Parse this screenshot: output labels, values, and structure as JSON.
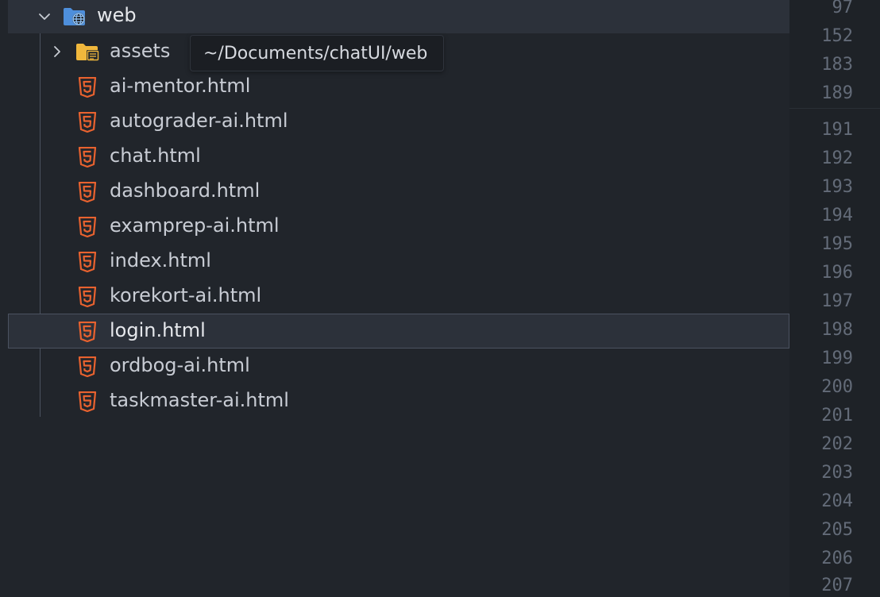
{
  "explorer": {
    "root": {
      "label": "web",
      "expanded": true,
      "icon": "web-folder-icon"
    },
    "items": [
      {
        "label": "assets",
        "type": "folder",
        "icon": "folder-icon"
      },
      {
        "label": "ai-mentor.html",
        "type": "html",
        "icon": "html5-icon"
      },
      {
        "label": "autograder-ai.html",
        "type": "html",
        "icon": "html5-icon"
      },
      {
        "label": "chat.html",
        "type": "html",
        "icon": "html5-icon"
      },
      {
        "label": "dashboard.html",
        "type": "html",
        "icon": "html5-icon"
      },
      {
        "label": "examprep-ai.html",
        "type": "html",
        "icon": "html5-icon"
      },
      {
        "label": "index.html",
        "type": "html",
        "icon": "html5-icon"
      },
      {
        "label": "korekort-ai.html",
        "type": "html",
        "icon": "html5-icon"
      },
      {
        "label": "login.html",
        "type": "html",
        "icon": "html5-icon",
        "selected": true
      },
      {
        "label": "ordbog-ai.html",
        "type": "html",
        "icon": "html5-icon"
      },
      {
        "label": "taskmaster-ai.html",
        "type": "html",
        "icon": "html5-icon"
      }
    ],
    "tooltip": "~/Documents/chatUI/web"
  },
  "gutter": {
    "line_numbers": [
      "97",
      "152",
      "183",
      "189",
      "191",
      "192",
      "193",
      "194",
      "195",
      "196",
      "197",
      "198",
      "199",
      "200",
      "201",
      "202",
      "203",
      "204",
      "205",
      "206",
      "207"
    ]
  },
  "colors": {
    "background": "#21252b",
    "row_highlight": "#2c313a",
    "html_icon": "#e8622f",
    "folder_icon": "#f0b73c",
    "web_folder_icon": "#4e8fdc"
  }
}
